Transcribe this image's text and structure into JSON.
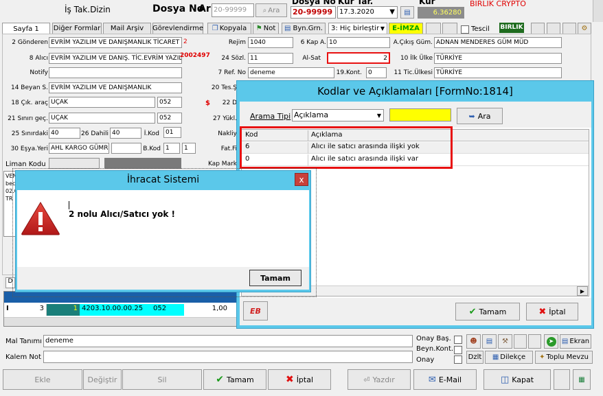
{
  "header": {
    "is_takip_dizin": "İş Tak.Dizin",
    "dosya_no_label": "Dosya No",
    "dosya_no_ara": "Ar",
    "dosya_no_placeholder": "20-99999",
    "ara_label": "Ara",
    "dosya_no_value_top": "Dosya No",
    "dosya_no_value": "20-99999",
    "kur_tar_label": "Kur Tar.",
    "kur_tar_value": "17.3.2020",
    "kur_label": "Kur",
    "kur_value": "6.36280",
    "firm": "BIRLIK CRYPTO"
  },
  "tabs": {
    "sayfa1": "Sayfa 1",
    "diger_formlar": "Diğer Formlar",
    "mail_arsiv": "Mail Arşiv",
    "gorevlendirme": "Görevlendirme",
    "kopyala": "Kopyala",
    "not": "Not",
    "byn_grn": "Byn.Grn.",
    "hic_birlestir": "3: Hiç birleştir",
    "e_imza": "E-İMZA",
    "tescil": "Tescil",
    "birlik": "BIRLIK"
  },
  "form": {
    "gonderen_label": "2 Gönderen",
    "gonderen_value": "EVRİM YAZILIM VE DANIŞMANLIK TİCARET",
    "gonderen_flag": "2",
    "alici_label": "8 Alıcı",
    "alici_value": "EVRİM YAZILIM VE DANIŞ. TİC.EVRİM YAZILI",
    "alici_code": "2002497",
    "notify_label": "Notify",
    "beyan_label": "14 Beyan S.",
    "beyan_value": "EVRİM YAZILIM VE DANIŞMANLIK",
    "cik_arac_label": "18 Çık. araç",
    "cik_arac_value": "UÇAK",
    "cik_arac_code": "052",
    "sinir_gec_label": "21 Sınırı geç.",
    "sinir_gec_value": "UÇAK",
    "sinir_gec_code": "052",
    "sinirdaki_label": "25 Sınırdaki",
    "sinirdaki_value": "40",
    "dahili_label": "26 Dahili",
    "dahili_value": "40",
    "ikod_label": "İ.Kod",
    "ikod_value": "01",
    "esya_yeri_label": "30 Eşya.Yeri",
    "esya_yeri_value": "AHL KARGO GÜMR",
    "bkod_label": "B.Kod",
    "bkod_value1": "1",
    "bkod_value2": "1",
    "liman_kodu_label": "Liman Kodu",
    "rejim_label": "Rejim",
    "rejim_value": "1040",
    "kap_a_label": "6 Kap A.",
    "kap_a_value": "10",
    "cikis_gum_label": "A.Çıkış Güm.",
    "cikis_gum_value": "ADNAN MENDERES GÜM MÜD",
    "sozl_label": "24 Sözl.",
    "sozl_value": "11",
    "al_sat_label": "Al-Sat",
    "al_sat_value": "2",
    "ilk_ulke_label": "10 İlk Ülke",
    "ilk_ulke_value": "TÜRKİYE",
    "ref_no_label": "7 Ref. No",
    "ref_no_value": "deneme",
    "kont_label": "19.Kont.",
    "kont_value": "0",
    "tic_ulkesi_label": "11 Tic.Ülkesi",
    "tic_ulkesi_value": "TÜRKİYE",
    "tes_label": "20 Tes.Ş",
    "d22_label": "22 D",
    "yukl_label": "27 Yükl.",
    "nakliy_label": "Nakliy",
    "fat_fi_label": "Fat.Fi",
    "kap_mark_label": "Kap Mark",
    "dollar": "$",
    "notes_lines": [
      "VEN",
      "bec",
      "02.0",
      "TR"
    ]
  },
  "grid": {
    "row_mark": "I",
    "cells": [
      "3",
      "1",
      "4203.10.00.00.25",
      "052",
      "1,00"
    ]
  },
  "bottom": {
    "mal_tanimi_label": "Mal Tanımı",
    "mal_tanimi_value": "deneme",
    "kalem_not_label": "Kalem Not",
    "onay_bas_label": "Onay Baş.",
    "beyn_kont_label": "Beyn.Kont.",
    "onay_label": "Onay",
    "ekran_label": "Ekran",
    "dzlt_label": "Dzlt",
    "dilekce_label": "Dilekçe",
    "toplu_mevzu_label": "Toplu Mevzu",
    "ekle": "Ekle",
    "degistir": "Değiştir",
    "sil": "Sil",
    "tamam": "Tamam",
    "iptal": "İptal",
    "yazdir": "Yazdır",
    "email": "E-Mail",
    "kapat": "Kapat"
  },
  "kodlar_dialog": {
    "title": "Kodlar ve Açıklamaları [FormNo:1814]",
    "arama_tipi_label": "Arama Tipi",
    "arama_tipi_value": "Açıklama",
    "ara_button": "Ara",
    "col_kod": "Kod",
    "col_aciklama": "Açıklama",
    "rows": [
      {
        "kod": "6",
        "aciklama": "Alıcı ile satıcı arasında ilişki yok"
      },
      {
        "kod": "0",
        "aciklama": "Alıcı ile satıcı arasında ilişki var"
      }
    ],
    "tamam": "Tamam",
    "iptal": "İptal"
  },
  "message_dialog": {
    "title": "İhracat Sistemi",
    "message": "2 nolu Alıcı/Satıcı yok !",
    "ok_button": "Tamam",
    "close": "x"
  },
  "colors": {
    "dialog_blue": "#5bc8ea",
    "highlight_red": "#e81010",
    "yellow": "#ffff00",
    "teal": "#1a7f7a",
    "cyan": "#00ffff"
  }
}
